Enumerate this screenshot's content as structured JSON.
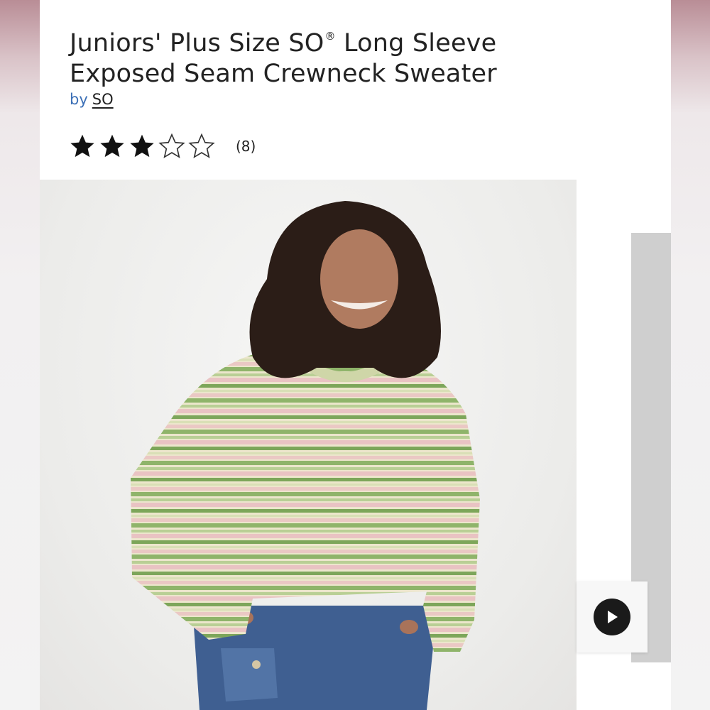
{
  "product": {
    "title_main": "Juniors' Plus Size SO",
    "title_mark": "®",
    "title_rest": " Long Sleeve Exposed Seam Crewneck Sweater",
    "by_label": "by",
    "brand": "SO"
  },
  "rating": {
    "stars_filled": 3,
    "stars_total": 5,
    "count_text": "(8)"
  },
  "media": {
    "video_icon": "play-icon"
  },
  "colors": {
    "link_blue": "#3b6fb6",
    "sweater_green": "#8fb46a",
    "sweater_pink": "#e9c3c3",
    "denim": "#3f5f91"
  }
}
